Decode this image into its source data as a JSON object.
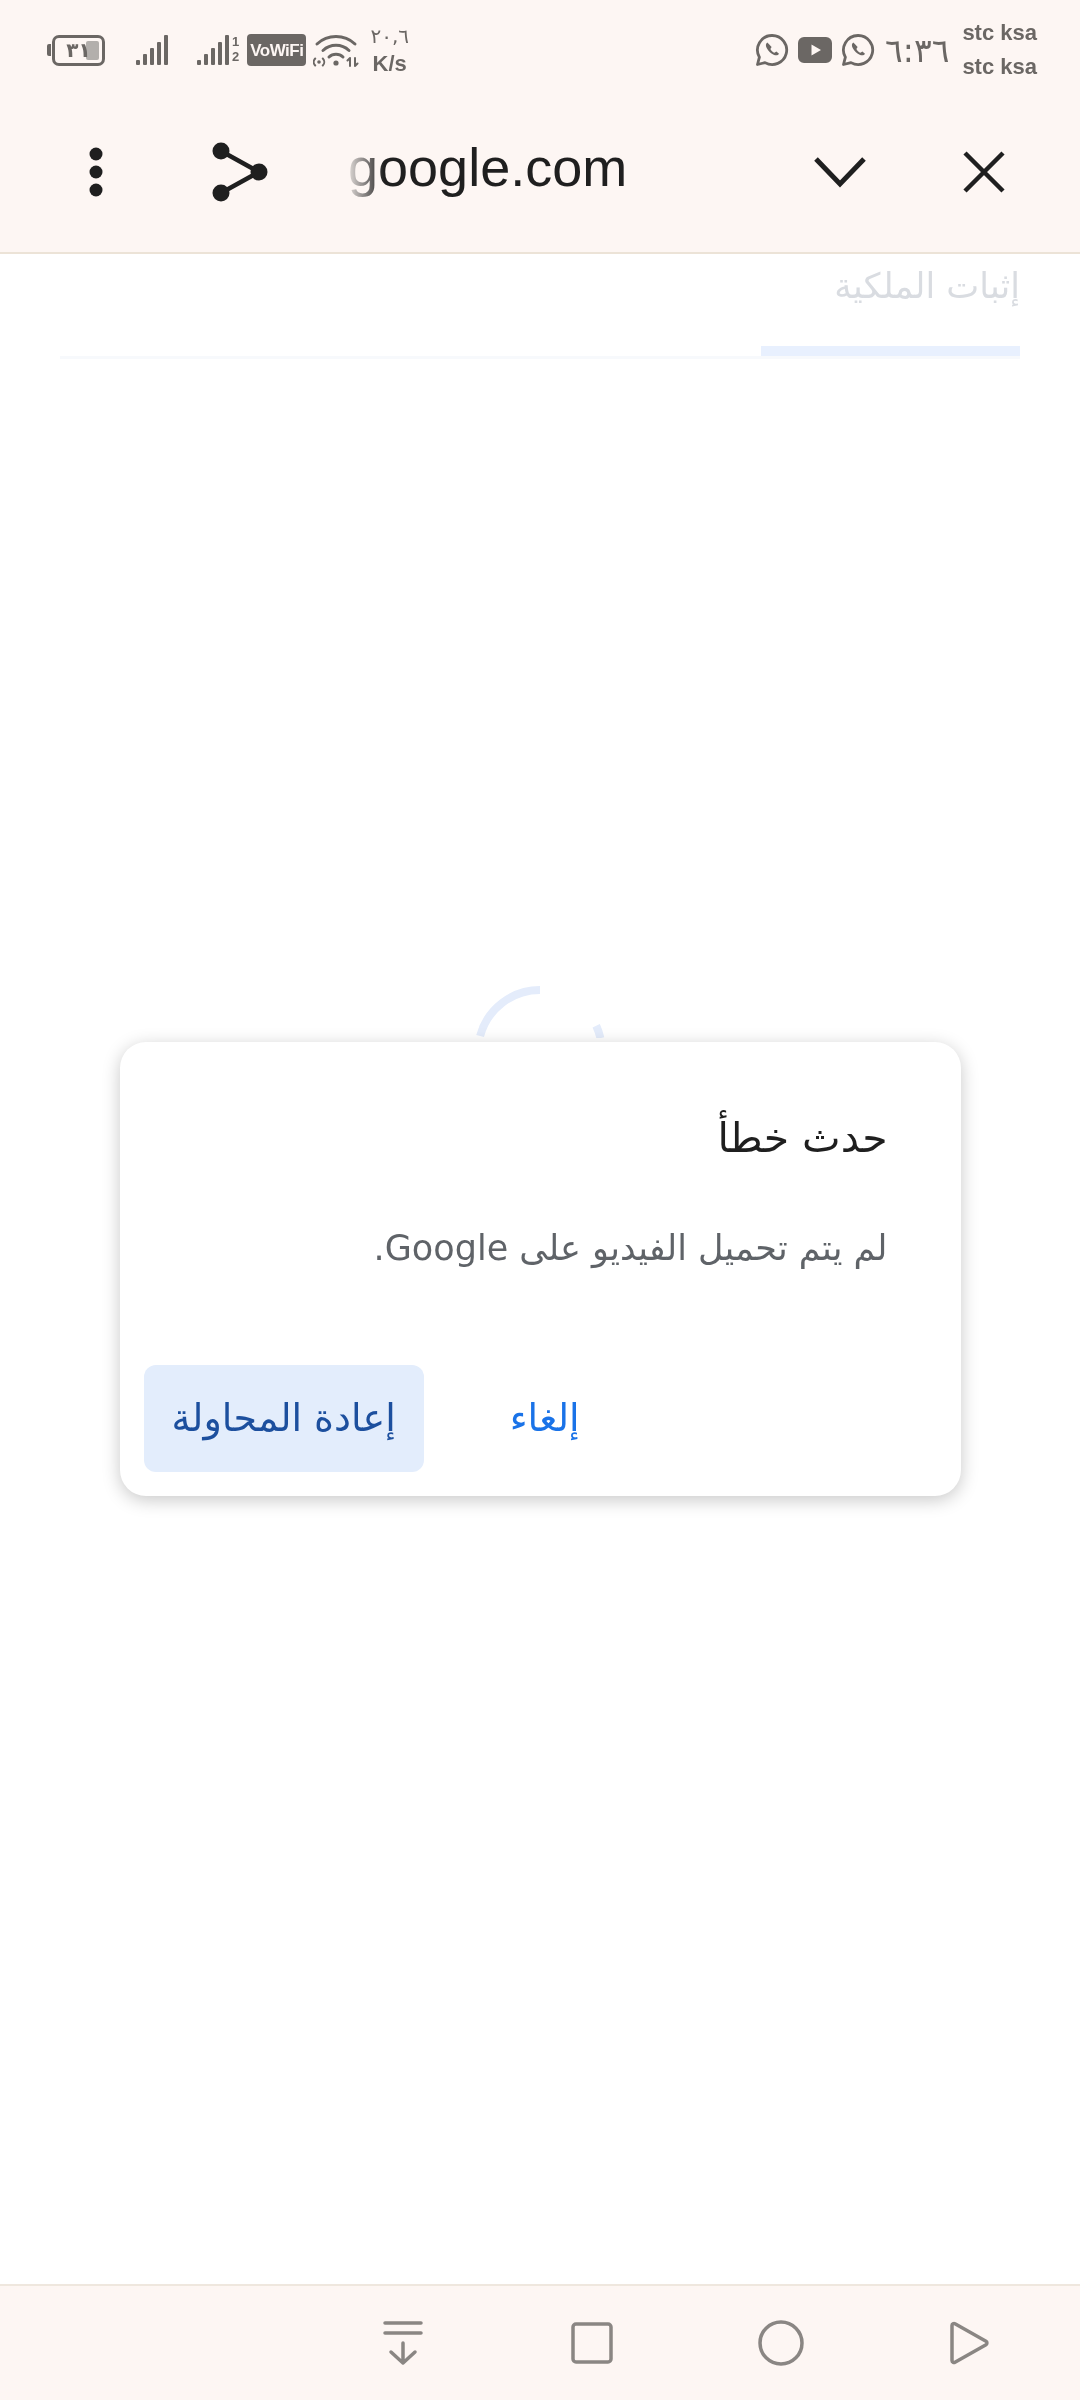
{
  "status_bar": {
    "battery_text": "٣١",
    "signal_sim_labels": [
      "1",
      "2"
    ],
    "vowifi_badge": "VoWiFi",
    "network_speed": {
      "value": "٢٠,٦",
      "unit": "K/s"
    },
    "notifications": [
      {
        "kind": "chat"
      },
      {
        "kind": "video"
      },
      {
        "kind": "chat"
      }
    ],
    "time": "٦:٣٦",
    "carriers": [
      "stc ksa",
      "stc ksa"
    ]
  },
  "toolbar": {
    "url": "google.com"
  },
  "tabs": [
    {
      "label": "إثبات الملكية",
      "selected": true
    }
  ],
  "dialog": {
    "title": "حدث خطأ",
    "message": "لم يتم تحميل الفيديو على Google.",
    "buttons": [
      {
        "label": "إلغاء",
        "kind": "text"
      },
      {
        "label": "إعادة المحاولة",
        "kind": "tonal"
      }
    ]
  },
  "nav_bar": [
    {
      "kind": "hide"
    },
    {
      "kind": "recents"
    },
    {
      "kind": "home"
    },
    {
      "kind": "back"
    }
  ]
}
